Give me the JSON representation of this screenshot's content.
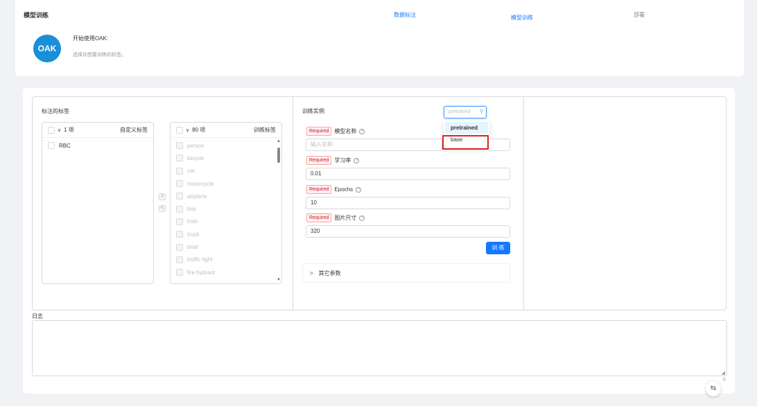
{
  "header": {
    "title": "模型训练",
    "nav": [
      "数据标注",
      "模型训练",
      "部署"
    ],
    "avatar_text": "OAK",
    "intro_title": "开始使用OAK:",
    "intro_sub": "选择你想要训练的标签。"
  },
  "labels_panel": {
    "title": "标注的标签",
    "left_list": {
      "count": "1 项",
      "header": "自定义标签",
      "items": [
        "RBC"
      ]
    },
    "right_list": {
      "count": "80 项",
      "header": "训练标签",
      "items": [
        "person",
        "bicycle",
        "car",
        "motorcycle",
        "airplane",
        "bus",
        "train",
        "truck",
        "boat",
        "traffic light",
        "fire hydrant"
      ]
    }
  },
  "train_panel": {
    "title": "训练实例",
    "select_placeholder": "pretrained",
    "dropdown_options": [
      "pretrained",
      "base"
    ],
    "required_tag": "Required",
    "fields": {
      "model_name": {
        "label": "模型名称",
        "placeholder": "输入名称"
      },
      "lr": {
        "label": "学习率",
        "value": "0.01"
      },
      "epochs": {
        "label": "Epochs",
        "value": "10"
      },
      "img_size": {
        "label": "图片尺寸",
        "value": "320"
      }
    },
    "train_button": "训 练",
    "more_params": "其它参数"
  },
  "log": {
    "label": "日志",
    "char_count": "0"
  },
  "colors": {
    "primary": "#1677ff",
    "avatar": "#1890d8",
    "highlight": "#e02020"
  }
}
